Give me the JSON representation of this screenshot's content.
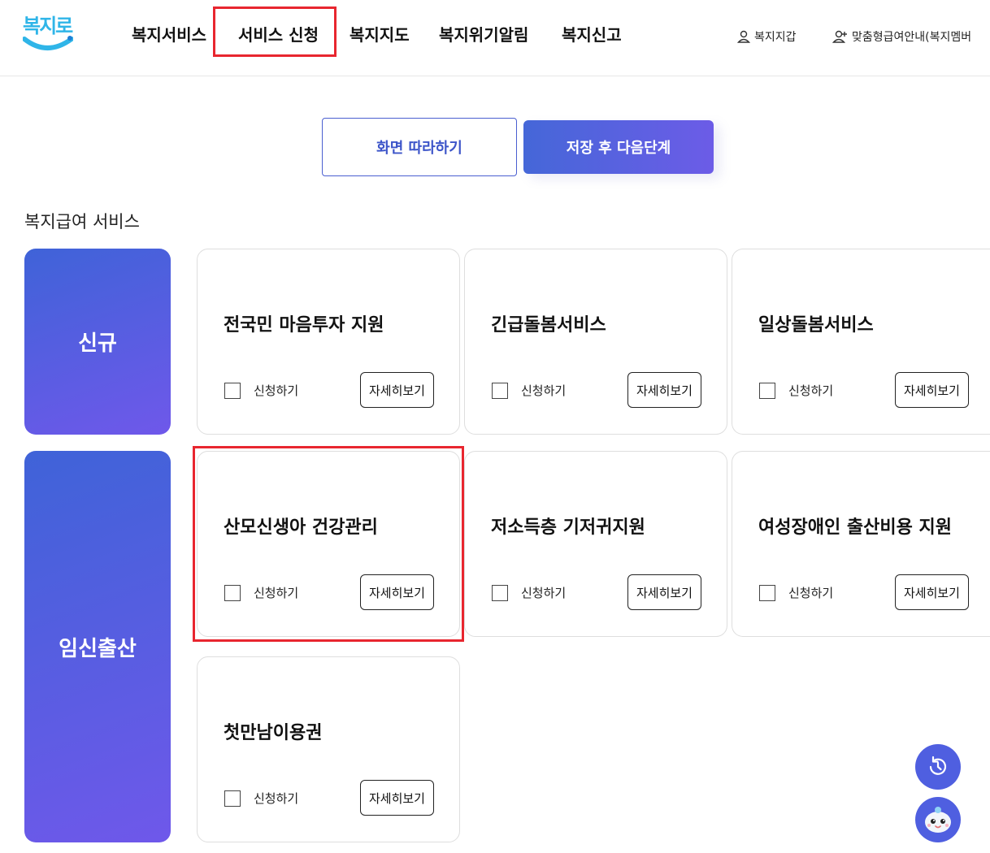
{
  "header": {
    "logo_text": "복지로",
    "nav": [
      {
        "label": "복지서비스"
      },
      {
        "label": "서비스 신청"
      },
      {
        "label": "복지지도"
      },
      {
        "label": "복지위기알림"
      },
      {
        "label": "복지신고"
      }
    ],
    "util": {
      "wallet": "복지지갑",
      "guide": "맞춤형급여안내(복지멤버"
    }
  },
  "steps": {
    "follow_label": "화면 따라하기",
    "save_label": "저장 후 다음단계"
  },
  "section_title": "복지급여 서비스",
  "categories": [
    {
      "label": "신규"
    },
    {
      "label": "임신출산"
    }
  ],
  "cards": [
    {
      "title": "전국민 마음투자 지원",
      "apply": "신청하기",
      "detail": "자세히보기"
    },
    {
      "title": "긴급돌봄서비스",
      "apply": "신청하기",
      "detail": "자세히보기"
    },
    {
      "title": "일상돌봄서비스",
      "apply": "신청하기",
      "detail": "자세히보기"
    },
    {
      "title": "산모신생아 건강관리",
      "apply": "신청하기",
      "detail": "자세히보기"
    },
    {
      "title": "저소득층 기저귀지원",
      "apply": "신청하기",
      "detail": "자세히보기"
    },
    {
      "title": "여성장애인 출산비용 지원",
      "apply": "신청하기",
      "detail": "자세히보기"
    },
    {
      "title": "첫만남이용권",
      "apply": "신청하기",
      "detail": "자세히보기"
    }
  ],
  "colors": {
    "accent": "#4f5fe0",
    "highlight": "#e8262f",
    "logo": "#2fb5e8"
  }
}
